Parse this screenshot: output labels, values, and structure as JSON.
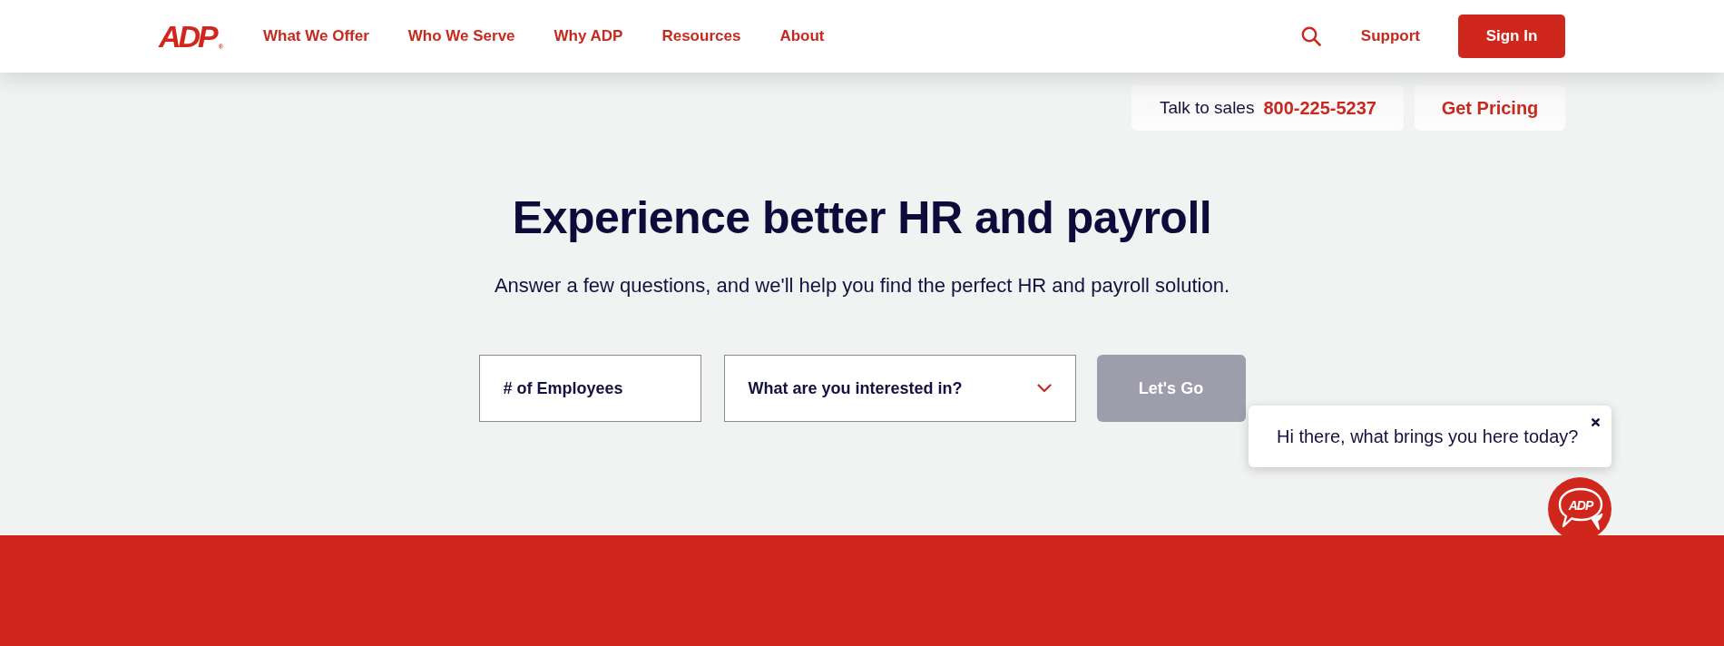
{
  "header": {
    "logo": {
      "text": "ADP",
      "mark": "®"
    },
    "nav": [
      "What We Offer",
      "Who We Serve",
      "Why ADP",
      "Resources",
      "About"
    ],
    "support": "Support",
    "sign_in": "Sign In"
  },
  "contact_bar": {
    "sales_label": "Talk to sales",
    "phone": "800-225-5237",
    "pricing_button": "Get Pricing"
  },
  "hero": {
    "title": "Experience better HR and payroll",
    "subtitle": "Answer a few questions, and we'll help you find the perfect HR and payroll solution.",
    "employees_field": {
      "placeholder": "# of Employees"
    },
    "interest_dropdown": {
      "placeholder": "What are you interested in?"
    },
    "submit_button": {
      "label": "Let's Go",
      "disabled": true
    }
  },
  "chat": {
    "message": "Hi there, what brings you here today?",
    "launcher_logo": "ADP"
  }
}
